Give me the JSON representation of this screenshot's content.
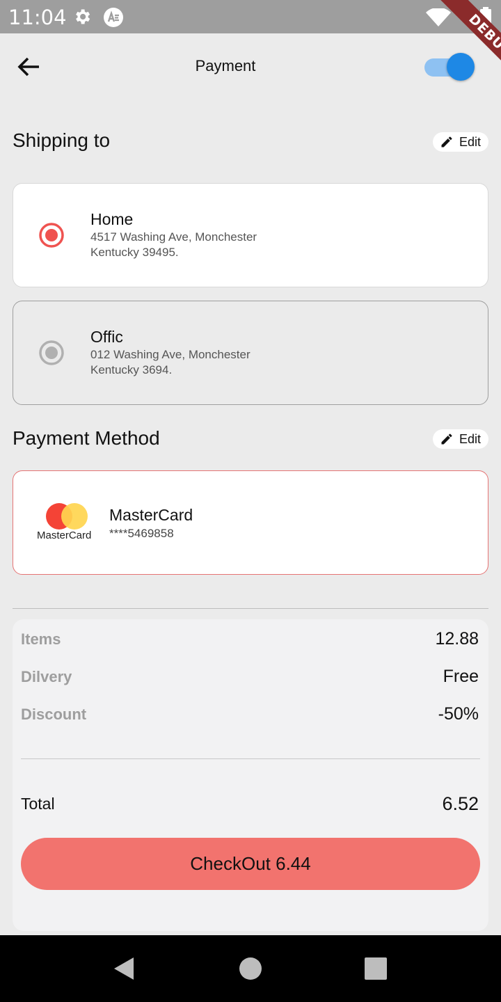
{
  "status_bar": {
    "time": "11:04",
    "debug_label": "DEBUG"
  },
  "header": {
    "title": "Payment",
    "toggle_on": true
  },
  "shipping": {
    "title": "Shipping to",
    "edit_label": "Edit",
    "addresses": [
      {
        "name": "Home",
        "line1": "4517 Washing Ave, Monchester",
        "line2": "Kentucky 39495.",
        "selected": true
      },
      {
        "name": "Offic",
        "line1": "012 Washing Ave, Monchester",
        "line2": "Kentucky 3694.",
        "selected": false
      }
    ]
  },
  "payment": {
    "title": "Payment Method",
    "edit_label": "Edit",
    "card": {
      "logo_caption": "MasterCard",
      "name": "MasterCard",
      "number": "****5469858"
    }
  },
  "summary": {
    "rows": [
      {
        "label": "Items",
        "value": "12.88"
      },
      {
        "label": "Dilvery",
        "value": "Free"
      },
      {
        "label": "Discount",
        "value": "-50%"
      }
    ],
    "total_label": "Total",
    "total_value": "6.52",
    "checkout_label": "CheckOut 6.44"
  },
  "colors": {
    "accent": "#f2736e",
    "selected_radio": "#ef5350",
    "toggle": "#1e88e5",
    "background": "#ebebeb"
  }
}
